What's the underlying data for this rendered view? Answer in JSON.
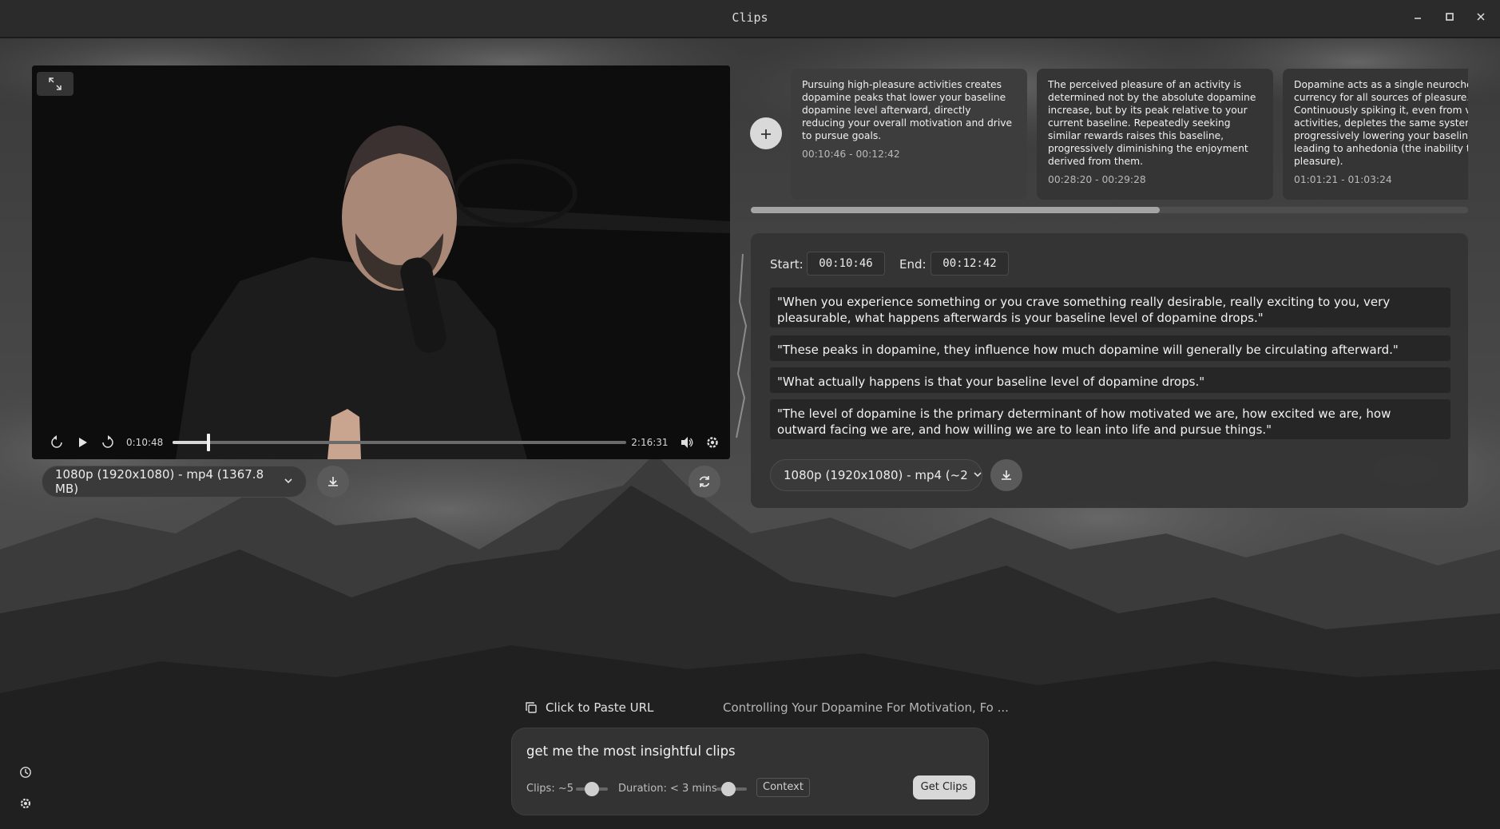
{
  "window": {
    "title": "Clips"
  },
  "player": {
    "current_time": "0:10:48",
    "duration": "2:16:31",
    "progress": 0.079,
    "format": "1080p (1920x1080) - mp4 (1367.8 MB)"
  },
  "cards": [
    {
      "text": "Pursuing high-pleasure activities creates dopamine peaks that lower your baseline dopamine level afterward, directly reducing your overall motivation and drive to pursue goals.",
      "time": "00:10:46 - 00:12:42"
    },
    {
      "text": "The perceived pleasure of an activity is determined not by the absolute dopamine increase, but by its peak relative to your current baseline. Repeatedly seeking similar rewards raises this baseline, progressively diminishing the enjoyment derived from them.",
      "time": "00:28:20 - 00:29:28"
    },
    {
      "text": "Dopamine acts as a single neurochemical currency for all sources of pleasure. Continuously spiking it, even from various activities, depletes the same system, progressively lowering your baseline and leading to anhedonia (the inability to feel pleasure).",
      "time": "01:01:21 - 01:03:24"
    }
  ],
  "card_scroll_fraction": 0.57,
  "detail": {
    "start_label": "Start:",
    "start_value": "00:10:46",
    "end_label": "End:",
    "end_value": "00:12:42",
    "quotes": [
      "\"When you experience something or you crave something really desirable, really exciting to you, very pleasurable, what happens afterwards is your baseline level of dopamine drops.\"",
      "\"These peaks in dopamine, they influence how much dopamine will generally be circulating afterward.\"",
      "\"What actually happens is that your baseline level of dopamine drops.\"",
      "\"The level of dopamine is the primary determinant of how motivated we are, how excited we are, how outward facing we are, and how willing we are to lean into life and pursue things.\""
    ],
    "format": "1080p (1920x1080) - mp4 (~2"
  },
  "prompt": {
    "paste_label": "Click to Paste URL",
    "video_title": "Controlling Your Dopamine For Motivation, Fo ...",
    "query": "get me the most insightful clips",
    "clips_label": "Clips: ~5",
    "clips_level": 0.5,
    "duration_label": "Duration: < 3 mins",
    "duration_level": 0.4,
    "context_label": "Context",
    "submit_label": "Get Clips"
  },
  "icons": [
    "expand-icon",
    "rewind-15-icon",
    "play-icon",
    "forward-15-icon",
    "volume-icon",
    "settings-icon",
    "download-icon",
    "refresh-icon",
    "plus-icon",
    "copy-icon",
    "history-icon",
    "gear-icon",
    "minimize-icon",
    "maximize-icon",
    "close-icon"
  ]
}
